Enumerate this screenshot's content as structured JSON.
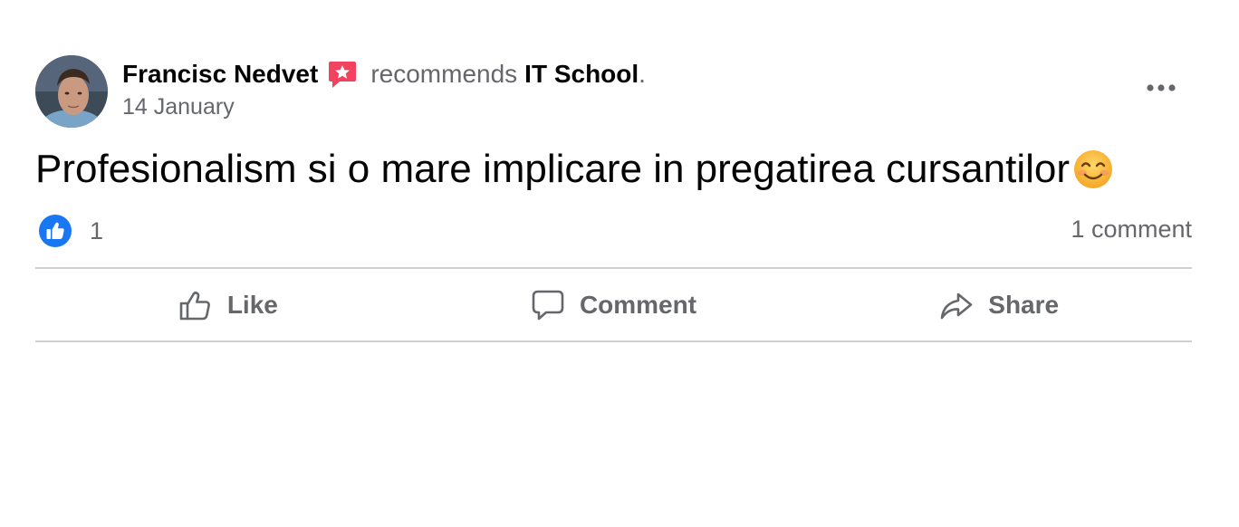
{
  "post": {
    "author": "Francisc Nedvet",
    "recommends_text": "recommends",
    "page_name": "IT School",
    "period": ".",
    "date": "14 January",
    "text": "Profesionalism si o mare implicare in pregatirea cursantilor",
    "emoji": "smiling-face-emoji"
  },
  "stats": {
    "reaction_count": "1",
    "comment_count": "1 comment"
  },
  "actions": {
    "like_label": "Like",
    "comment_label": "Comment",
    "share_label": "Share"
  },
  "colors": {
    "accent_blue": "#1877f2",
    "secondary_text": "#65676b",
    "recommend_badge": "#f3425f",
    "divider": "#ced0d4"
  }
}
